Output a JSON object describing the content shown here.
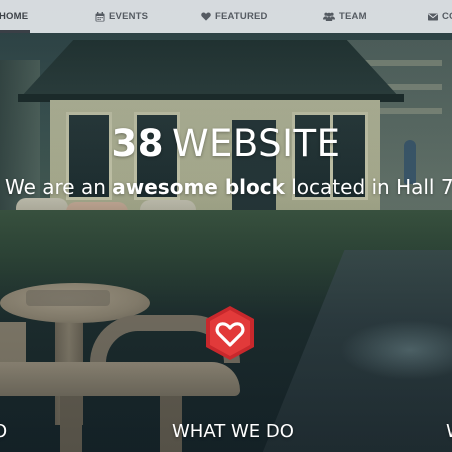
{
  "nav": {
    "home": "HOME",
    "events": "EVENTS",
    "featured": "FEATURED",
    "team": "TEAM",
    "contact": "CO"
  },
  "hero": {
    "title_number": "38",
    "title_word": "WEBSITE",
    "subtitle_pre": "We are an ",
    "subtitle_bold": "awesome block",
    "subtitle_post": " located in Hall 7"
  },
  "sections": {
    "left_fragment": "O",
    "middle": "WHAT WE DO",
    "right_fragment": "W"
  },
  "icons": {
    "events": "calendar-icon",
    "featured": "heart-icon",
    "team": "users-icon",
    "contact": "envelope-icon",
    "feature": "heart-hexagon-icon"
  },
  "colors": {
    "navbar_bg": "#e1e4e8",
    "nav_text": "#555b62",
    "hero_text": "#ffffff",
    "accent_red": "#e23a3a"
  }
}
